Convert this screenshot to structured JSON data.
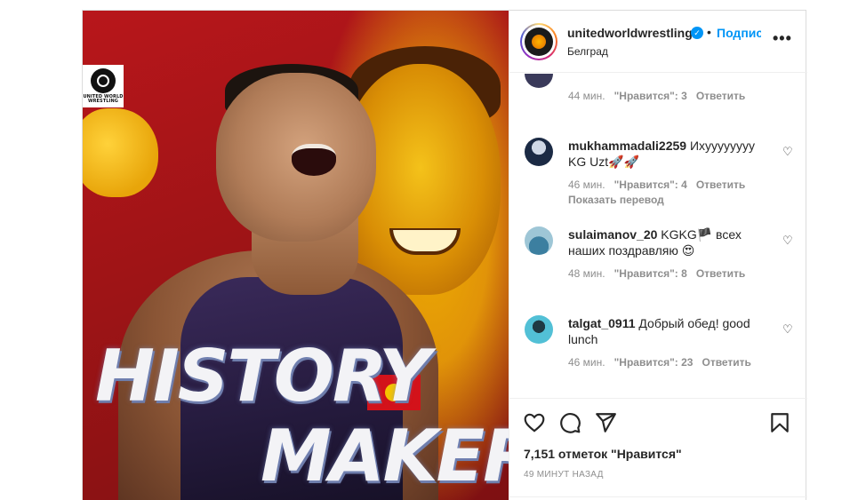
{
  "post": {
    "image": {
      "alt": "",
      "headline_line1": "HISTORY",
      "headline_line2": "MAKER",
      "logo_text_1": "UNITED WORLD",
      "logo_text_2": "WRESTLING"
    },
    "header": {
      "username": "unitedworldwrestling",
      "verified_icon": "verified-badge-icon",
      "separator": "•",
      "follow_label": "Подписаться",
      "location": "Белград",
      "more_label": "•••"
    },
    "comments": [
      {
        "username": "",
        "text": "",
        "time": "44 мин.",
        "likes": "\"Нравится\": 3",
        "reply": "Ответить",
        "avatar_color": "#3a3a5a"
      },
      {
        "username": "mukhammadali2259",
        "text": "Ихуууууууу 🇰🇬🇺🇿🚀🚀",
        "text_display": "Ихуууууууу KG Uzt🚀🚀",
        "time": "46 мин.",
        "likes": "\"Нравится\": 4",
        "reply": "Ответить",
        "translate": "Показать перевод",
        "avatar_color": "#1b2a44"
      },
      {
        "username": "sulaimanov_20",
        "text": "🇰🇬🇰🇬🇰🇬 всех наших поздравляю 😍",
        "text_display": "KGKG🏴 всех наших поздравляю 😍",
        "time": "48 мин.",
        "likes": "\"Нравится\": 8",
        "reply": "Ответить",
        "avatar_color": "#6aa3b8"
      },
      {
        "username": "talgat_0911",
        "text": "Добрый обед! good lunch",
        "time": "46 мин.",
        "likes": "\"Нравится\": 23",
        "reply": "Ответить",
        "avatar_color": "#3fb0c8"
      }
    ],
    "actions": {
      "like_icon": "heart-icon",
      "comment_icon": "comment-icon",
      "share_icon": "send-icon",
      "save_icon": "bookmark-icon",
      "likes_count": "7,151 отметок \"Нравится\"",
      "time_ago": "49 МИНУТ НАЗАД"
    }
  },
  "colors": {
    "accent_blue": "#0095f6",
    "muted_text": "#8e8e8e",
    "border": "#dbdbdb"
  }
}
